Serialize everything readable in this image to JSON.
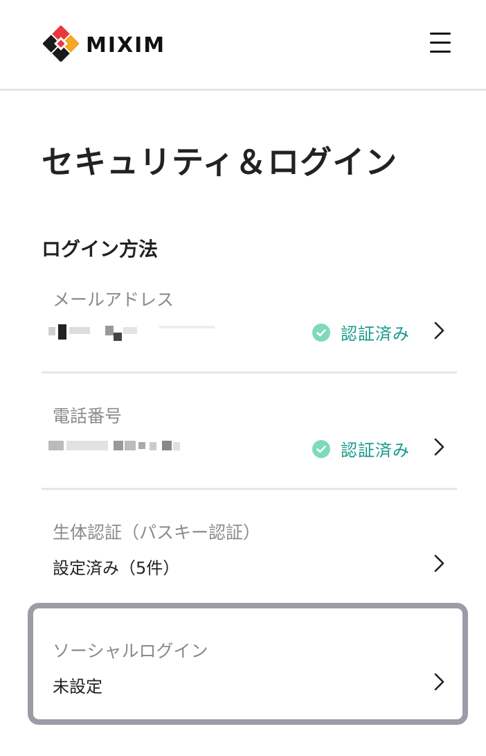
{
  "header": {
    "brand": "MIXIM",
    "logo_icon": "mixim-logo-icon",
    "menu_icon": "hamburger-menu-icon"
  },
  "page": {
    "title": "セキュリティ＆ログイン",
    "section_title": "ログイン方法"
  },
  "login_methods": [
    {
      "label": "メールアドレス",
      "value_masked": "***********",
      "status": "認証済み",
      "status_icon": "check-circle-icon"
    },
    {
      "label": "電話番号",
      "value_masked": "***-****-****",
      "status": "認証済み",
      "status_icon": "check-circle-icon"
    },
    {
      "label": "生体認証（パスキー認証）",
      "value": "設定済み（5件）"
    },
    {
      "label": "ソーシャルログイン",
      "value": "未設定"
    }
  ],
  "colors": {
    "verified_text": "#159a8a",
    "verified_icon_bg": "#7ed9bf",
    "highlight_border": "#9a9ca6",
    "divider": "#e6e6e6"
  }
}
